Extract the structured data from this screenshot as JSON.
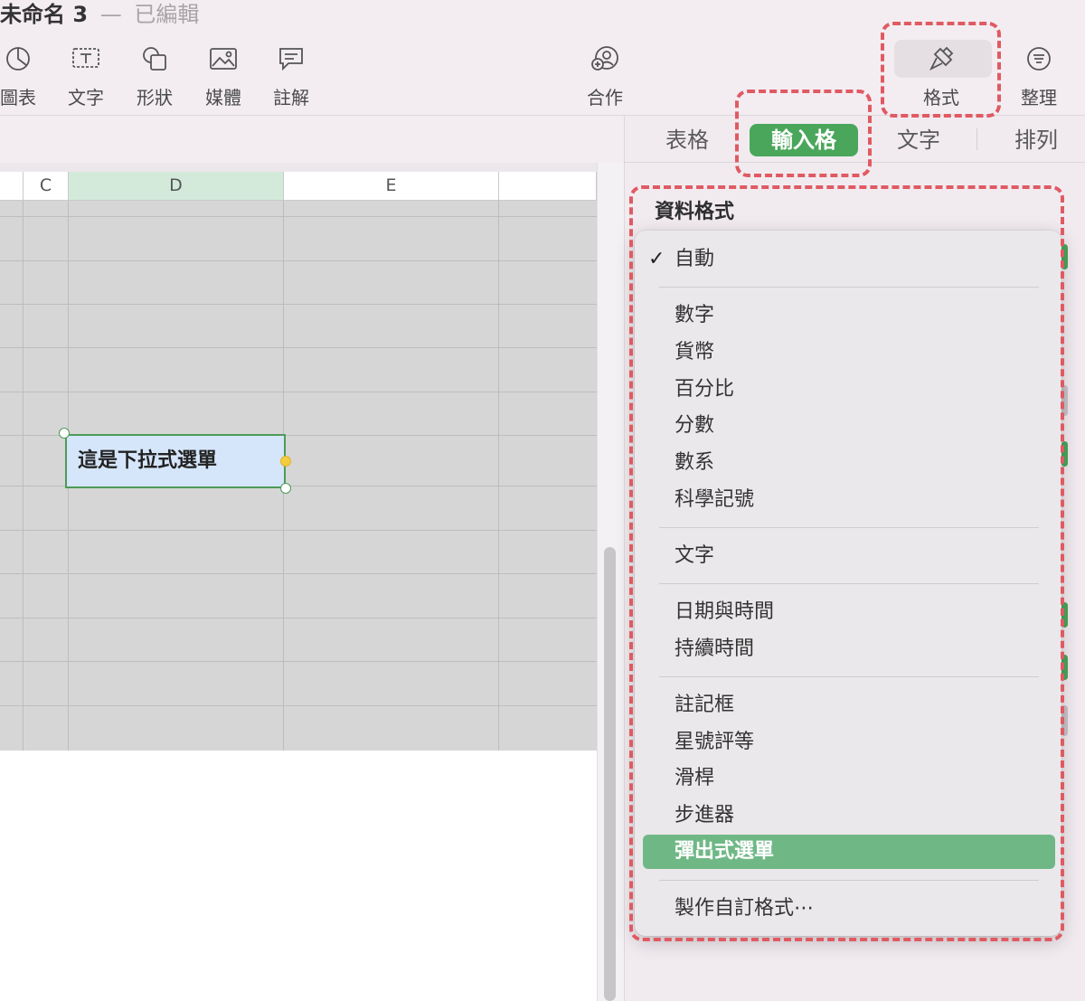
{
  "window": {
    "doc_name": "未命名 3",
    "separator": "—",
    "status": "已編輯"
  },
  "toolbar": {
    "items": [
      {
        "label": "圖表",
        "icon": "chart-icon"
      },
      {
        "label": "文字",
        "icon": "text-box-icon"
      },
      {
        "label": "形狀",
        "icon": "shape-icon"
      },
      {
        "label": "媒體",
        "icon": "media-icon"
      },
      {
        "label": "註解",
        "icon": "comment-icon"
      },
      {
        "label": "合作",
        "icon": "collaborate-icon"
      },
      {
        "label": "格式",
        "icon": "paintbrush-icon"
      },
      {
        "label": "整理",
        "icon": "organize-icon"
      }
    ]
  },
  "sheet": {
    "columns": [
      "C",
      "D",
      "E"
    ],
    "selected_column": "D",
    "selected_cell_text": "這是下拉式選單"
  },
  "inspector": {
    "tabs": [
      "表格",
      "輸入格",
      "文字",
      "排列"
    ],
    "active_tab": "輸入格",
    "section_title": "資料格式"
  },
  "menu": {
    "groups": [
      [
        "自動"
      ],
      [
        "數字",
        "貨幣",
        "百分比",
        "分數",
        "數系",
        "科學記號"
      ],
      [
        "文字"
      ],
      [
        "日期與時間",
        "持續時間"
      ],
      [
        "註記框",
        "星號評等",
        "滑桿",
        "步進器",
        "彈出式選單"
      ],
      [
        "製作自訂格式⋯"
      ]
    ],
    "checked": "自動",
    "highlighted": "彈出式選單",
    "check_glyph": "✓"
  },
  "colors": {
    "accent_green": "#4aa65a",
    "highlight_green": "#6fb886",
    "annotation_red": "#e05a62"
  }
}
